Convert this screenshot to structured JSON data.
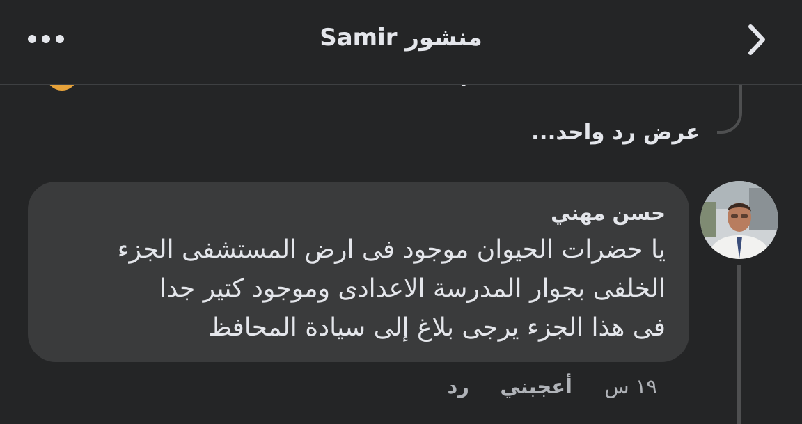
{
  "header": {
    "title": "منشور Samir"
  },
  "view_replies": "عرض رد واحد...",
  "comment": {
    "author": "حسن مهني",
    "lines": [
      "يا حضرات الحيوان موجود فى ارض المستشفى الجزء",
      "الخلفى بجوار المدرسة الاعدادى وموجود كتير جدا",
      "فى هذا الجزء يرجى بلاغ إلى سيادة المحافظ"
    ],
    "time": "١٩ س",
    "like_label": "أعجبني",
    "reply_label": "رد"
  },
  "icons": {
    "more": "more-horizontal-icon",
    "back": "chevron-right-icon"
  },
  "colors": {
    "background": "#242526",
    "bubble": "#3a3b3c",
    "primary_text": "#e4e6eb",
    "secondary_text": "#b0b3b8"
  }
}
